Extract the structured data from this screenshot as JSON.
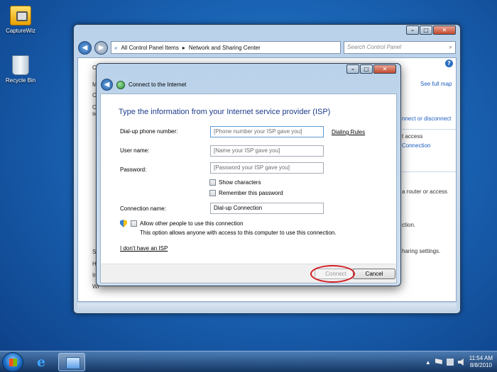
{
  "desktop": {
    "icons": [
      {
        "label": "CaptureWiz"
      },
      {
        "label": "Recycle Bin"
      }
    ]
  },
  "explorer": {
    "breadcrumb": [
      "All Control Panel Items",
      "Network and Sharing Center"
    ],
    "search_placeholder": "Search Control Panel",
    "see_full_map": "See full map",
    "right_fragments": [
      "nnect or disconnect",
      "t access",
      "Connection",
      "a router or access",
      "ction.",
      "haring settings."
    ],
    "left_fragments": [
      "Co",
      "M",
      "Ch",
      "Ch",
      "se",
      "Se",
      "He",
      "Int",
      "Wi"
    ]
  },
  "dialog": {
    "title": "Connect to the Internet",
    "heading": "Type the information from your Internet service provider (ISP)",
    "fields": {
      "phone_label": "Dial-up phone number:",
      "phone_placeholder": "[Phone number your ISP gave you]",
      "dialing_rules": "Dialing Rules",
      "user_label": "User name:",
      "user_placeholder": "[Name your ISP gave you]",
      "password_label": "Password:",
      "password_placeholder": "[Password your ISP gave you]",
      "show_characters": "Show characters",
      "remember_password": "Remember this password",
      "connection_label": "Connection name:",
      "connection_value": "Dial-up Connection"
    },
    "allow_others": "Allow other people to use this connection",
    "allow_others_note": "This option allows anyone with access to this computer to use this connection.",
    "no_isp_link": "I don't have an ISP",
    "connect_button": "Connect",
    "cancel_button": "Cancel"
  },
  "taskbar": {
    "time": "11:54 AM",
    "date": "8/8/2010"
  }
}
